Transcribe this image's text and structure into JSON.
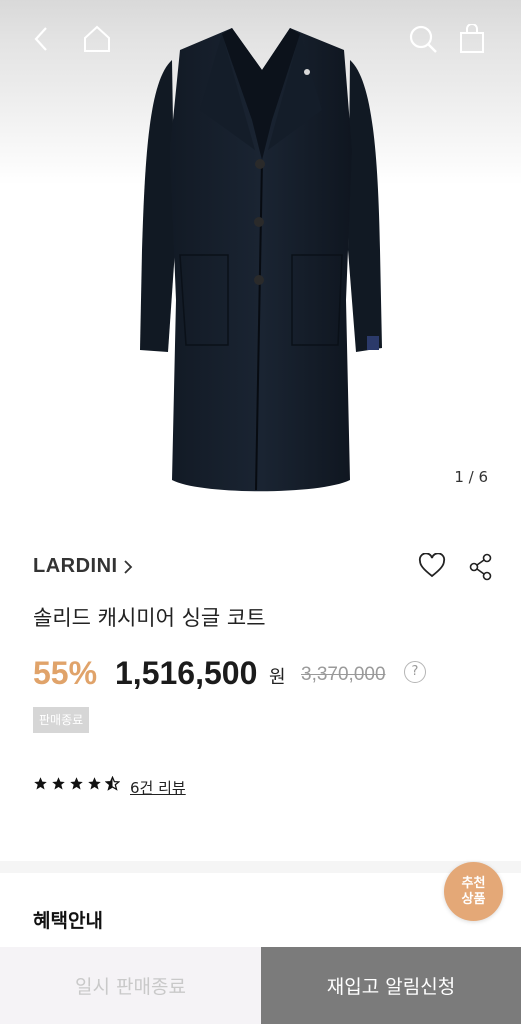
{
  "gallery": {
    "page_indicator": "1 / 6"
  },
  "product": {
    "brand": "LARDINI",
    "name": "솔리드 캐시미어 싱글 코트",
    "discount": "55%",
    "price": "1,516,500",
    "currency": "원",
    "original_price": "3,370,000",
    "help_mark": "?",
    "status_badge": "판매종료",
    "rating": 4.5,
    "review_link": "6건 리뷰"
  },
  "sections": {
    "benefit_title": "혜택안내"
  },
  "fab": {
    "line1": "추천",
    "line2": "상품"
  },
  "bottom_bar": {
    "sold_out_label": "일시 판매종료",
    "restock_label": "재입고 알림신청"
  },
  "icons": {
    "back": "chevron-left-icon",
    "home": "home-icon",
    "search": "search-icon",
    "cart": "shopping-bag-icon",
    "wishlist": "heart-icon",
    "share": "share-icon"
  },
  "colors": {
    "discount": "#e0a36a",
    "fab": "#e4a877",
    "restock_button": "#7b7b7b"
  }
}
